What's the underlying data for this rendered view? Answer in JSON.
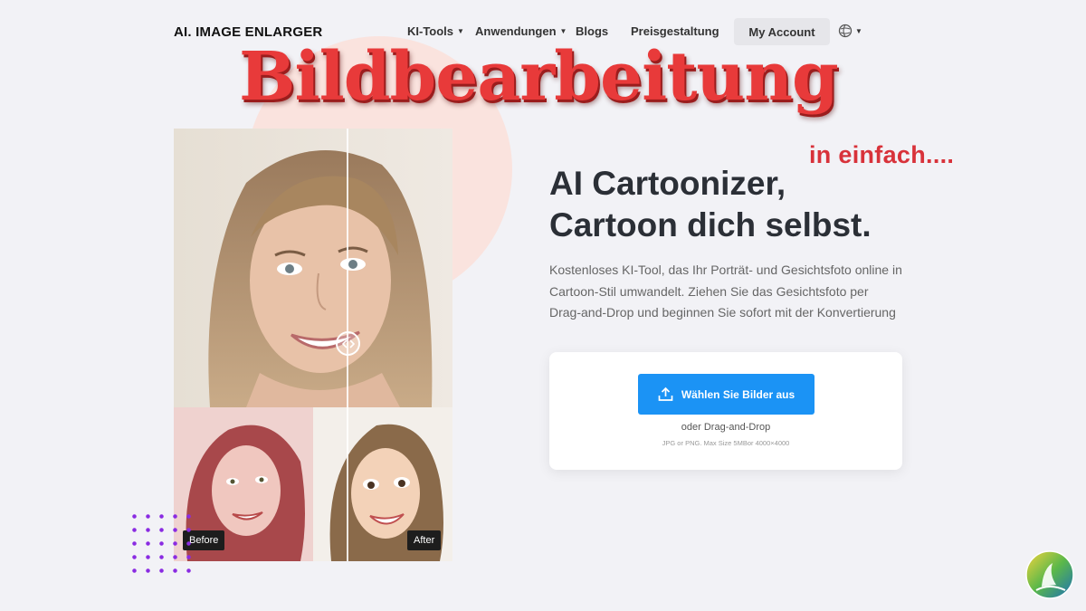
{
  "nav": {
    "logo": "AI. IMAGE ENLARGER",
    "items": [
      {
        "label": "KI-Tools",
        "has_caret": true
      },
      {
        "label": "Anwendungen",
        "has_caret": true
      },
      {
        "label": "Blogs",
        "has_caret": false
      },
      {
        "label": "Preisgestaltung",
        "has_caret": false
      }
    ],
    "account_button": "My Account",
    "language_icon": "language-globe-icon"
  },
  "overlay": {
    "title": "Bildbearbeitung",
    "subtitle": "in einfach...."
  },
  "hero": {
    "headline_line1": "AI Cartoonizer,",
    "headline_line2": "Cartoon dich selbst.",
    "description": "Kostenloses KI-Tool, das Ihr Porträt- und Gesichtsfoto online in Cartoon-Stil umwandelt. Ziehen Sie das Gesichtsfoto per Drag-and-Drop und beginnen Sie sofort mit der Konvertierung"
  },
  "comparison": {
    "before_label": "Before",
    "after_label": "After"
  },
  "upload": {
    "button_label": "Wählen Sie Bilder aus",
    "drop_text": "oder Drag-and-Drop",
    "hint": "JPG or PNG. Max Size 5MBor 4000×4000"
  },
  "colors": {
    "accent": "#1b93f5",
    "title_red": "#e83a3a",
    "dots": "#8a2be2"
  }
}
